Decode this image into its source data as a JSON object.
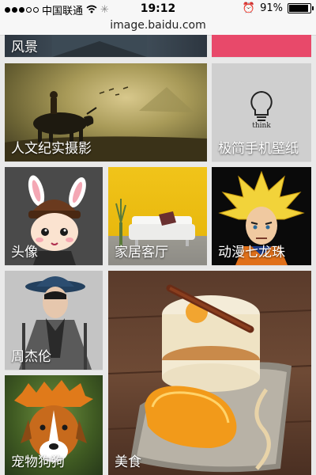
{
  "status_bar": {
    "carrier": "中国联通",
    "time": "19:12",
    "battery_percent": "91%",
    "signal_dots_filled": 3,
    "signal_dots_total": 5
  },
  "address_bar": {
    "url": "image.baidu.com"
  },
  "categories": [
    {
      "label": "风景"
    },
    {
      "label": "人文纪实摄影"
    },
    {
      "label": "极简手机壁纸",
      "image_text": "think"
    },
    {
      "label": "头像"
    },
    {
      "label": "家居客厅"
    },
    {
      "label": "动漫七龙珠"
    },
    {
      "label": "周杰伦"
    },
    {
      "label": "美食"
    },
    {
      "label": "宠物狗狗"
    }
  ]
}
